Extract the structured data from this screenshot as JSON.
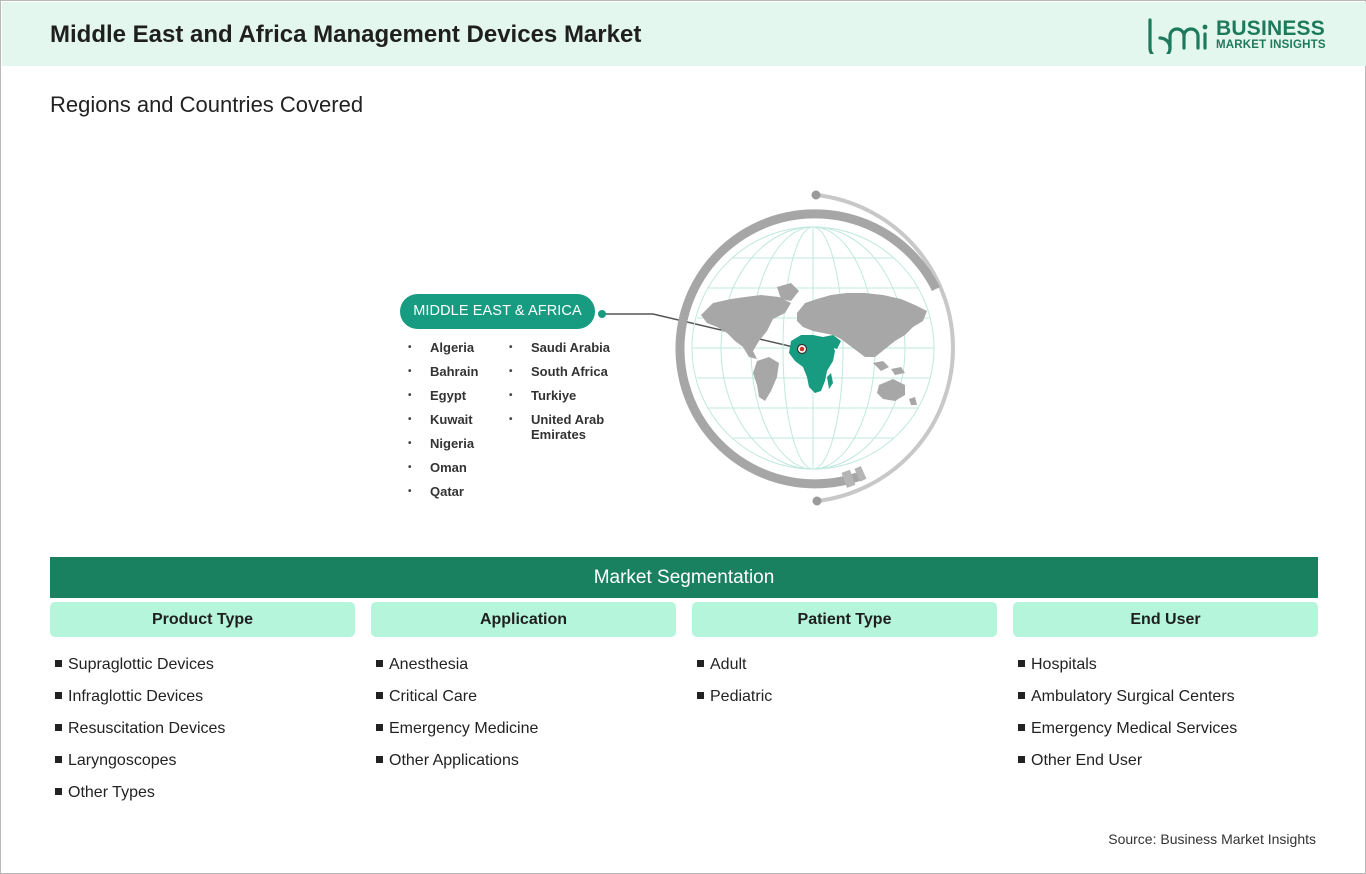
{
  "header": {
    "title": "Middle East and Africa Management Devices Market",
    "logo": {
      "line1": "BUSINESS",
      "line2": "MARKET INSIGHTS",
      "mark": "bmi-logo-mark"
    }
  },
  "subtitle": "Regions and Countries Covered",
  "region": {
    "label": "MIDDLE EAST & AFRICA",
    "countries_col1": [
      "Algeria",
      "Bahrain",
      "Egypt",
      "Kuwait",
      "Nigeria",
      "Oman",
      "Qatar"
    ],
    "countries_col2": [
      "Saudi Arabia",
      "South Africa",
      "Turkiye",
      "United Arab Emirates"
    ]
  },
  "segmentation": {
    "title": "Market Segmentation",
    "columns": [
      {
        "heading": "Product Type",
        "items": [
          "Supraglottic Devices",
          "Infraglottic Devices",
          "Resuscitation Devices",
          "Laryngoscopes",
          "Other Types"
        ]
      },
      {
        "heading": "Application",
        "items": [
          "Anesthesia",
          "Critical Care",
          "Emergency Medicine",
          "Other Applications"
        ]
      },
      {
        "heading": "Patient Type",
        "items": [
          "Adult",
          "Pediatric"
        ]
      },
      {
        "heading": "End User",
        "items": [
          "Hospitals",
          "Ambulatory Surgical Centers",
          "Emergency Medical Services",
          "Other End User"
        ]
      }
    ]
  },
  "source": "Source: Business Market Insights",
  "colors": {
    "header_bg": "#e4f7ee",
    "brand_green": "#1e7a5c",
    "pill": "#179c82",
    "seg_bar": "#1a8160",
    "seg_head": "#b4f5dc"
  }
}
